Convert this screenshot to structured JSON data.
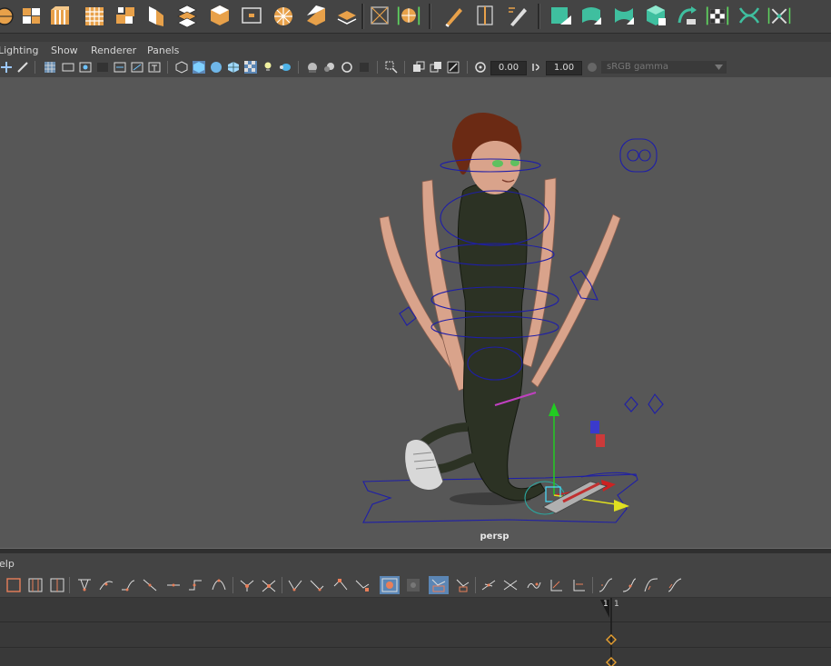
{
  "colors": {
    "shelf_bg": "#444444",
    "viewport_bg": "#575757",
    "icon_orange": "#e8a14a",
    "icon_teal": "#3fbf9f",
    "rig_blue": "#1e1ea8",
    "skin": "#d9a38b",
    "suit": "#2c3224",
    "selected_green": "#5fd35f"
  },
  "menubar": {
    "items": [
      {
        "label": "Lighting"
      },
      {
        "label": "Show"
      },
      {
        "label": "Renderer"
      },
      {
        "label": "Panels"
      }
    ]
  },
  "viewport_toolbar": {
    "field_a": "0.00",
    "field_b": "1.00",
    "color_space": "sRGB gamma"
  },
  "viewport": {
    "camera_label": "persp"
  },
  "graph_editor": {
    "menu_fragment": "elp",
    "current_frame": "1",
    "frame_tick": "1"
  },
  "shelf_icons": [
    "poly-sphere-icon",
    "poly-cube-icon",
    "poly-cylinder-icon",
    "poly-grid-icon",
    "poly-plane-icon",
    "poly-prism-icon",
    "poly-pyramid-icon",
    "poly-pipe-icon",
    "poly-box-icon",
    "poly-soccer-icon",
    "poly-disc-icon",
    "poly-helix-icon",
    "combine-icon",
    "select-frame-icon",
    "sculpt-sphere-icon",
    "pen-icon",
    "bounding-box-icon",
    "edit-pen-icon",
    "paint-square-icon",
    "bend-icon",
    "shelf-extrude-icon",
    "cube-checker-icon",
    "curve-arrow-icon",
    "render-checker-icon",
    "twist-icon",
    "deform-x-icon"
  ]
}
